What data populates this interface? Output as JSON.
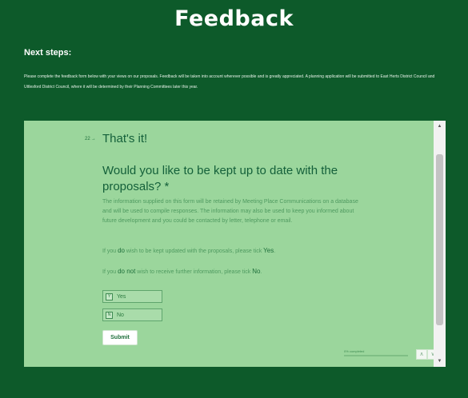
{
  "page": {
    "title": "Feedback",
    "next_steps_heading": "Next steps:",
    "intro_text": "Please complete the feedback form below with your views on our proposals. Feedback will be taken into account wherever possible and is greatly appreciated. A planning application will be submitted to East Herts District Council and Uttlesford District Council, where it will be determined by their Planning Committees later this year."
  },
  "form": {
    "question_number": "22",
    "question_arrow": "→",
    "section_heading": "That's it!",
    "question": "Would you like to be kept up to date with the proposals? *",
    "info": "The information supplied on this form will be retained by Meeting Place Communications on a database and will be used to compile responses. The information may also be used to keep you informed about future development and you could be contacted by letter, telephone or email.",
    "yes_line": {
      "pre": "If you ",
      "emph1": "do",
      "mid": " wish to be kept updated with the proposals, please tick ",
      "emph2": "Yes",
      "post": "."
    },
    "no_line": {
      "pre": "If you ",
      "emph1": "do not",
      "mid": " wish to receive further information, please tick ",
      "emph2": "No",
      "post": "."
    },
    "choices": [
      {
        "key": "Y",
        "label": "Yes"
      },
      {
        "key": "N",
        "label": "No"
      }
    ],
    "submit_label": "Submit",
    "progress_text": "0% completed",
    "progress_fraction": 0,
    "nav_up": "∧",
    "nav_down": "∨"
  },
  "scrollbar": {
    "up_arrow": "▲",
    "down_arrow": "▼"
  },
  "colors": {
    "page_bg": "#0d5a2a",
    "form_bg": "#9bd69c",
    "text_dark_green": "#14603a"
  }
}
